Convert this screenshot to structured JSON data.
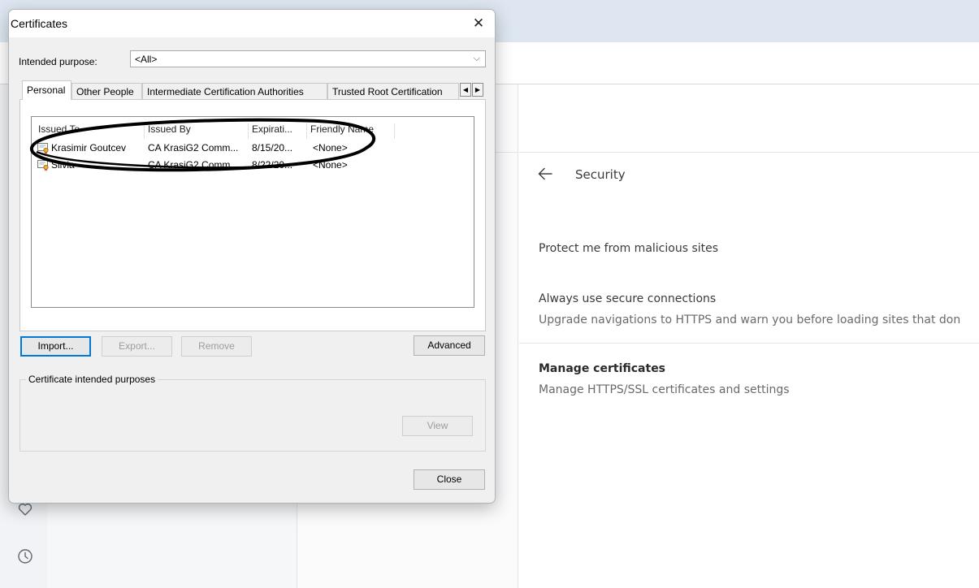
{
  "dialog": {
    "title": "Certificates",
    "close_glyph": "✕",
    "purpose_label": "Intended purpose:",
    "purpose_value": "<All>",
    "purpose_chevron": "⌵",
    "tabs": [
      {
        "label": "Personal"
      },
      {
        "label": "Other People"
      },
      {
        "label": "Intermediate Certification Authorities"
      },
      {
        "label": "Trusted Root Certification"
      }
    ],
    "tab_scroll_left": "◀",
    "tab_scroll_right": "▶",
    "columns": [
      "Issued To",
      "Issued By",
      "Expirati...",
      "Friendly Name"
    ],
    "rows": [
      {
        "issued_to": "Krasimir Goutcev",
        "issued_by": "CA KrasiG2 Comm...",
        "expiration": "8/15/20...",
        "friendly_name": "<None>",
        "icon": "certificate-icon"
      },
      {
        "issued_to": "Silvia",
        "issued_by": "CA KrasiG2 Comm...",
        "expiration": "8/22/20...",
        "friendly_name": "<None>",
        "icon": "certificate-icon"
      }
    ],
    "buttons": {
      "import": "Import...",
      "export": "Export...",
      "remove": "Remove",
      "advanced": "Advanced",
      "view": "View",
      "close": "Close"
    },
    "purposes_group_label": "Certificate intended purposes"
  },
  "settings": {
    "title": "Security",
    "items": [
      {
        "title": "Protect me from malicious sites"
      },
      {
        "title": "Always use secure connections",
        "subtitle": "Upgrade navigations to HTTPS and warn you before loading sites that don"
      },
      {
        "title": "Manage certificates",
        "subtitle": "Manage HTTPS/SSL certificates and settings"
      }
    ]
  },
  "colors": {
    "dialog_bg": "#f0f0f0",
    "default_button_border": "#0078d7",
    "annotation_ellipse": "#000000",
    "browser_titlebar": "#dee7f1"
  }
}
